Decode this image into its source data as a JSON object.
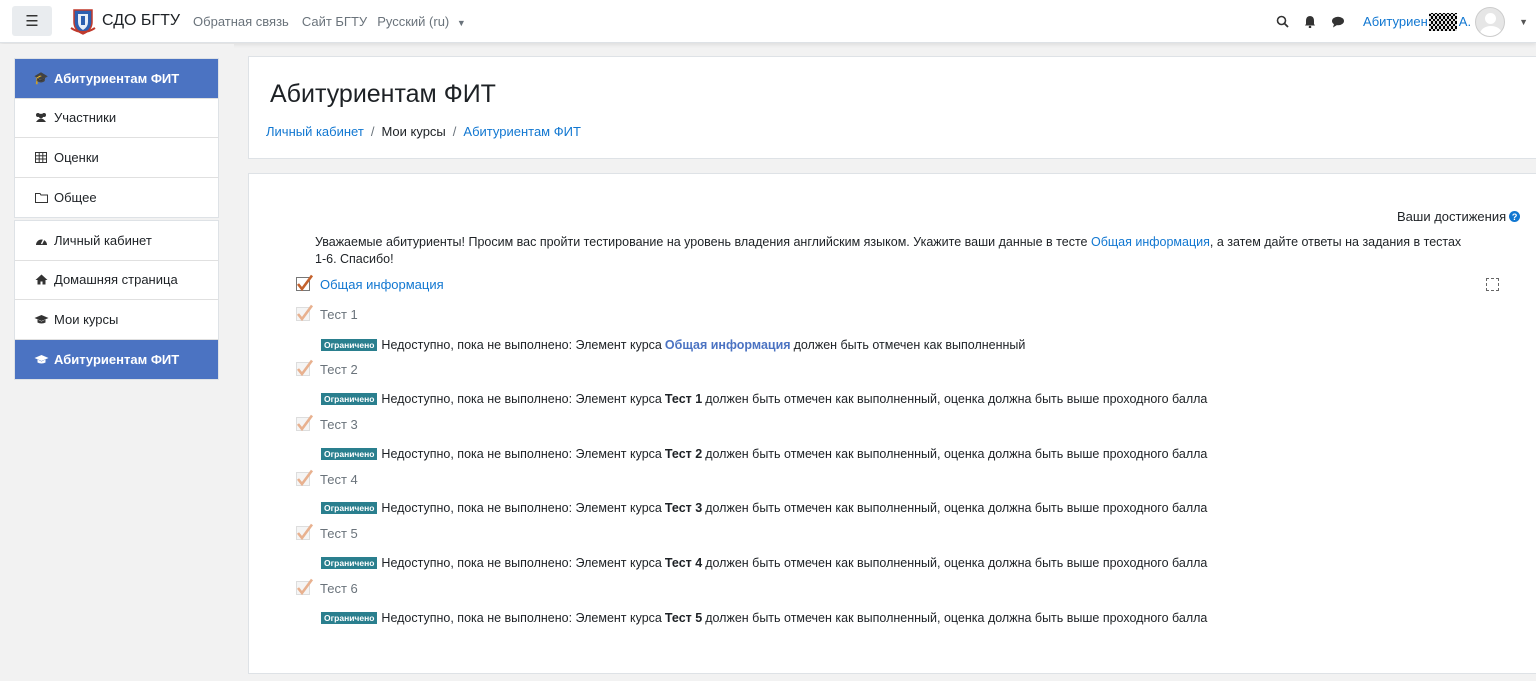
{
  "navbar": {
    "menu_icon": "hamburger-icon",
    "brand": "СДО БГТУ",
    "links": [
      "Обратная связь",
      "Сайт БГТУ"
    ],
    "language": "Русский (ru)",
    "icons": [
      "search-icon",
      "bell-icon",
      "chat-icon"
    ],
    "user_name": "Абитуриен",
    "user_initial": "А."
  },
  "drawer": {
    "course": [
      {
        "label": "Абитуриентам ФИТ",
        "icon": "graduation-cap-icon",
        "active": true
      },
      {
        "label": "Участники",
        "icon": "users-icon",
        "active": false
      },
      {
        "label": "Оценки",
        "icon": "table-icon",
        "active": false
      },
      {
        "label": "Общее",
        "icon": "folder-icon",
        "active": false
      }
    ],
    "site": [
      {
        "label": "Личный кабинет",
        "icon": "dashboard-icon",
        "active": false
      },
      {
        "label": "Домашняя страница",
        "icon": "home-icon",
        "active": false
      },
      {
        "label": "Мои курсы",
        "icon": "graduation-cap-icon",
        "active": false
      },
      {
        "label": "Абитуриентам ФИТ",
        "icon": "graduation-cap-icon",
        "active": true
      }
    ]
  },
  "header": {
    "title": "Абитуриентам ФИТ",
    "breadcrumb": [
      "Личный кабинет",
      "Мои курсы",
      "Абитуриентам ФИТ"
    ],
    "breadcrumb_sep": "/"
  },
  "content": {
    "achievements": "Ваши достижения",
    "intro_before": "Уважаемые абитуриенты! Просим вас пройти тестирование на уровень владения английским языком. Укажите ваши данные в тесте ",
    "intro_link": "Общая информация",
    "intro_after": ", а затем дайте ответы на задания в  тестах 1-6. Спасибо!",
    "activities": [
      {
        "name": "Общая информация",
        "enabled": true
      },
      {
        "name": "Тест 1",
        "enabled": false
      },
      {
        "name": "Тест 2",
        "enabled": false
      },
      {
        "name": "Тест 3",
        "enabled": false
      },
      {
        "name": "Тест 4",
        "enabled": false
      },
      {
        "name": "Тест 5",
        "enabled": false
      },
      {
        "name": "Тест 6",
        "enabled": false
      }
    ],
    "badge": "Ограничено",
    "restrictions": [
      {
        "prefix": "Недоступно, пока не выполнено: Элемент курса",
        "item": "Общая информация",
        "suffix": "должен быть отмечен как выполненный"
      },
      {
        "prefix": "Недоступно, пока не выполнено: Элемент курса",
        "item": "Тест 1",
        "suffix": "должен быть отмечен как выполненный, оценка должна быть выше проходного балла"
      },
      {
        "prefix": "Недоступно, пока не выполнено: Элемент курса",
        "item": "Тест 2",
        "suffix": "должен быть отмечен как выполненный, оценка должна быть выше проходного балла"
      },
      {
        "prefix": "Недоступно, пока не выполнено: Элемент курса",
        "item": "Тест 3",
        "suffix": "должен быть отмечен как выполненный, оценка должна быть выше проходного балла"
      },
      {
        "prefix": "Недоступно, пока не выполнено: Элемент курса",
        "item": "Тест 4",
        "suffix": "должен быть отмечен как выполненный, оценка должна быть выше проходного балла"
      },
      {
        "prefix": "Недоступно, пока не выполнено: Элемент курса",
        "item": "Тест 5",
        "suffix": "должен быть отмечен как выполненный, оценка должна быть выше проходного балла"
      }
    ]
  },
  "colors": {
    "accent": "#4b73c2",
    "link": "#1177d1",
    "badge": "#2a7f8e"
  }
}
